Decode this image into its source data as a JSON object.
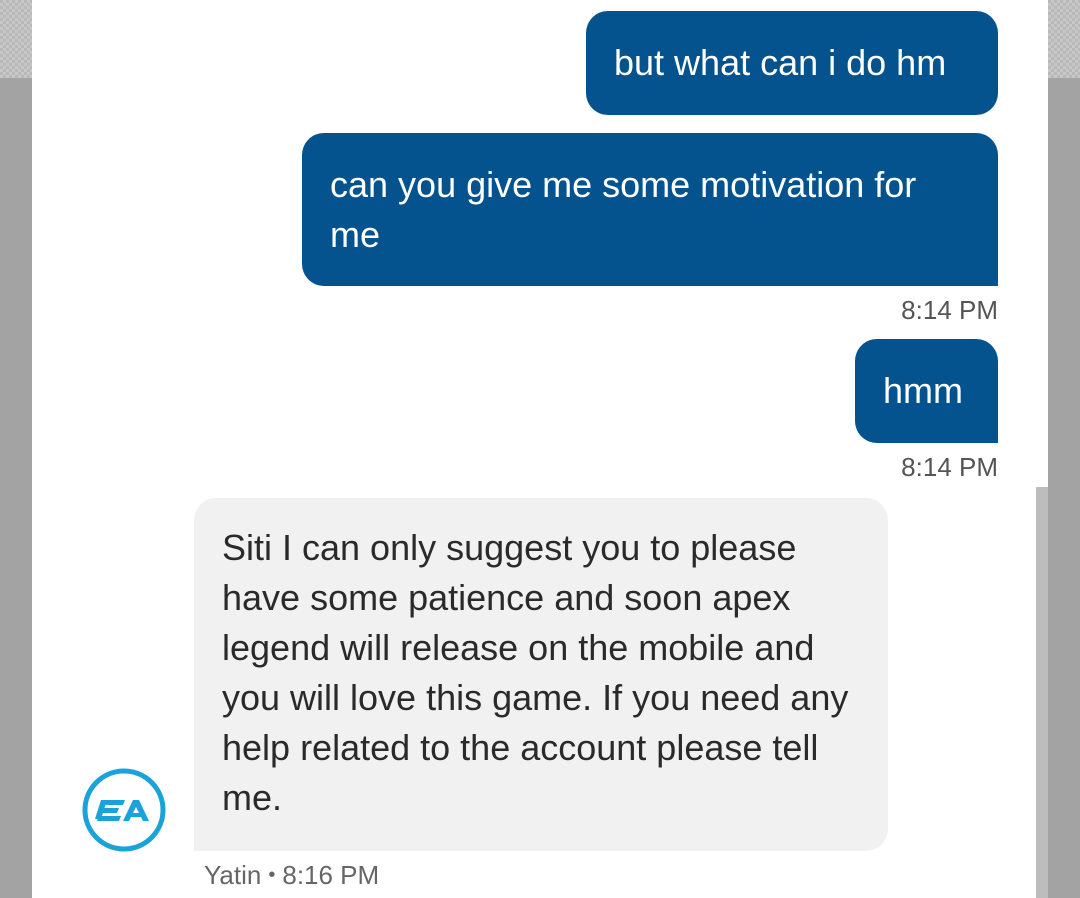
{
  "messages": {
    "outgoing": [
      {
        "text": "but what can i do hm"
      },
      {
        "text": "can you give me some motivation for me",
        "time": "8:14 PM"
      },
      {
        "text": "hmm",
        "time": "8:14 PM"
      }
    ],
    "incoming": {
      "text": "Siti I can only suggest you to please have some patience and soon apex legend will release on the mobile and you will love this game. If you need any help related to the account please tell me.",
      "sender": "Yatin",
      "separator": "•",
      "time": "8:16 PM",
      "avatar_icon": "ea-logo-icon"
    }
  },
  "colors": {
    "outgoing_bubble": "#04528e",
    "incoming_bubble": "#f1f1f1",
    "avatar_ring": "#1aa3d9"
  }
}
